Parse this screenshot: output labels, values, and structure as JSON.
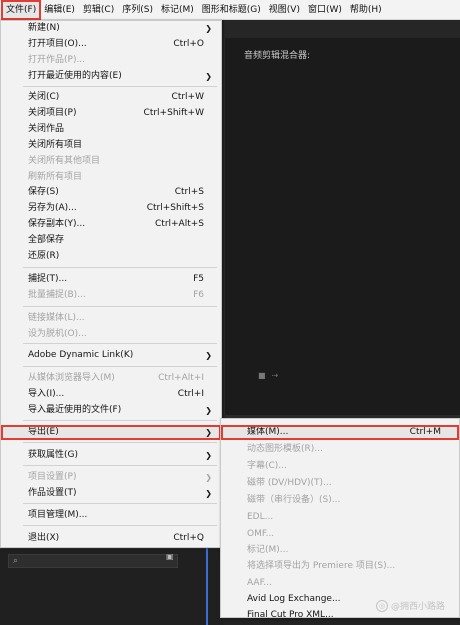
{
  "menubar": {
    "items": [
      "文件(F)",
      "编辑(E)",
      "剪辑(C)",
      "序列(S)",
      "标记(M)",
      "图形和标题(G)",
      "视图(V)",
      "窗口(W)",
      "帮助(H)"
    ],
    "active_index": 0
  },
  "panel": {
    "tab_label": "音频剪辑混合器:"
  },
  "file_menu": {
    "items": [
      {
        "label": "新建(N)",
        "shortcut": "",
        "submenu": true,
        "disabled": false
      },
      {
        "label": "打开项目(O)...",
        "shortcut": "Ctrl+O",
        "submenu": false,
        "disabled": false
      },
      {
        "label": "打开作品(P)...",
        "shortcut": "",
        "submenu": false,
        "disabled": true
      },
      {
        "label": "打开最近使用的内容(E)",
        "shortcut": "",
        "submenu": true,
        "disabled": false
      },
      {
        "label": "关闭(C)",
        "shortcut": "Ctrl+W",
        "submenu": false,
        "disabled": false
      },
      {
        "label": "关闭项目(P)",
        "shortcut": "Ctrl+Shift+W",
        "submenu": false,
        "disabled": false
      },
      {
        "label": "关闭作品",
        "shortcut": "",
        "submenu": false,
        "disabled": false
      },
      {
        "label": "关闭所有项目",
        "shortcut": "",
        "submenu": false,
        "disabled": false
      },
      {
        "label": "关闭所有其他项目",
        "shortcut": "",
        "submenu": false,
        "disabled": true
      },
      {
        "label": "刷新所有项目",
        "shortcut": "",
        "submenu": false,
        "disabled": true
      },
      {
        "label": "保存(S)",
        "shortcut": "Ctrl+S",
        "submenu": false,
        "disabled": false
      },
      {
        "label": "另存为(A)...",
        "shortcut": "Ctrl+Shift+S",
        "submenu": false,
        "disabled": false
      },
      {
        "label": "保存副本(Y)...",
        "shortcut": "Ctrl+Alt+S",
        "submenu": false,
        "disabled": false
      },
      {
        "label": "全部保存",
        "shortcut": "",
        "submenu": false,
        "disabled": false
      },
      {
        "label": "还原(R)",
        "shortcut": "",
        "submenu": false,
        "disabled": false
      },
      {
        "label": "捕捉(T)...",
        "shortcut": "F5",
        "submenu": false,
        "disabled": false
      },
      {
        "label": "批量捕捉(B)...",
        "shortcut": "F6",
        "submenu": false,
        "disabled": true
      },
      {
        "label": "链接媒体(L)...",
        "shortcut": "",
        "submenu": false,
        "disabled": true
      },
      {
        "label": "设为脱机(O)...",
        "shortcut": "",
        "submenu": false,
        "disabled": true
      },
      {
        "label": "Adobe Dynamic Link(K)",
        "shortcut": "",
        "submenu": true,
        "disabled": false
      },
      {
        "label": "从媒体浏览器导入(M)",
        "shortcut": "Ctrl+Alt+I",
        "submenu": false,
        "disabled": true
      },
      {
        "label": "导入(I)...",
        "shortcut": "Ctrl+I",
        "submenu": false,
        "disabled": false
      },
      {
        "label": "导入最近使用的文件(F)",
        "shortcut": "",
        "submenu": true,
        "disabled": false
      },
      {
        "label": "导出(E)",
        "shortcut": "",
        "submenu": true,
        "disabled": false
      },
      {
        "label": "获取属性(G)",
        "shortcut": "",
        "submenu": true,
        "disabled": false
      },
      {
        "label": "项目设置(P)",
        "shortcut": "",
        "submenu": true,
        "disabled": true
      },
      {
        "label": "作品设置(T)",
        "shortcut": "",
        "submenu": true,
        "disabled": false
      },
      {
        "label": "项目管理(M)...",
        "shortcut": "",
        "submenu": false,
        "disabled": false
      },
      {
        "label": "退出(X)",
        "shortcut": "Ctrl+Q",
        "submenu": false,
        "disabled": false
      }
    ],
    "highlighted_index": 23
  },
  "export_menu": {
    "items": [
      {
        "label": "媒体(M)...",
        "shortcut": "Ctrl+M",
        "disabled": false
      },
      {
        "label": "动态图形模板(R)...",
        "shortcut": "",
        "disabled": true
      },
      {
        "label": "字幕(C)...",
        "shortcut": "",
        "disabled": true
      },
      {
        "label": "磁带 (DV/HDV)(T)...",
        "shortcut": "",
        "disabled": true
      },
      {
        "label": "磁带（串行设备）(S)...",
        "shortcut": "",
        "disabled": true
      },
      {
        "label": "EDL...",
        "shortcut": "",
        "disabled": true
      },
      {
        "label": "OMF...",
        "shortcut": "",
        "disabled": true
      },
      {
        "label": "标记(M)...",
        "shortcut": "",
        "disabled": true
      },
      {
        "label": "将选择项导出为 Premiere 项目(S)...",
        "shortcut": "",
        "disabled": true
      },
      {
        "label": "AAF...",
        "shortcut": "",
        "disabled": true
      },
      {
        "label": "Avid Log Exchange...",
        "shortcut": "",
        "disabled": false
      },
      {
        "label": "Final Cut Pro XML...",
        "shortcut": "",
        "disabled": false
      }
    ],
    "highlighted_index": 0
  },
  "watermark": {
    "text": "@拥西小路路"
  },
  "colors": {
    "highlight": "#e03c31",
    "menu_bg": "#f2f2f2",
    "app_bg": "#232323"
  }
}
